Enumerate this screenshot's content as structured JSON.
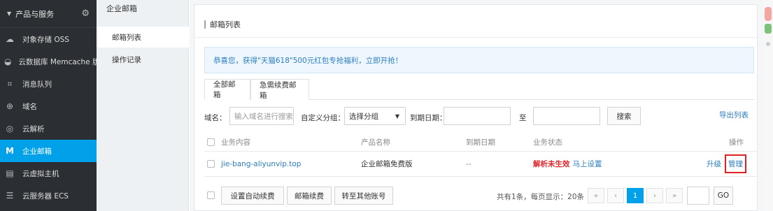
{
  "sidebar": {
    "header": "产品与服务",
    "items": [
      {
        "label": "对象存储 OSS",
        "icon": "cloud-icon"
      },
      {
        "label": "云数据库 Memcache 版",
        "icon": "database-icon"
      },
      {
        "label": "消息队列",
        "icon": "queue-icon"
      },
      {
        "label": "域名",
        "icon": "globe-icon"
      },
      {
        "label": "云解析",
        "icon": "dns-icon"
      },
      {
        "label": "企业邮箱",
        "icon": "mail-m-icon",
        "active": true
      },
      {
        "label": "云虚拟主机",
        "icon": "server-icon"
      },
      {
        "label": "云服务器 ECS",
        "icon": "ecs-icon"
      }
    ]
  },
  "subnav": {
    "title": "企业邮箱",
    "items": [
      {
        "label": "邮箱列表",
        "active": true
      },
      {
        "label": "操作记录"
      }
    ]
  },
  "main": {
    "title": "邮箱列表",
    "promo": "恭喜您，获得\"天猫618\"500元红包专抢福利，立即开抢！",
    "tabs": [
      "全部邮箱",
      "急需续费邮箱"
    ],
    "filters": {
      "domain_label": "域名：",
      "domain_placeholder": "输入域名进行搜索",
      "group_label": "自定义分组：",
      "group_value": "选择分组",
      "date_label": "到期日期：",
      "to": "至",
      "search": "搜索",
      "export": "导出列表"
    },
    "table": {
      "headers": [
        "业务内容",
        "产品名称",
        "到期日期",
        "业务状态",
        "操作"
      ],
      "rows": [
        {
          "content": "jie-bang-aliyunvip.top",
          "product": "企业邮箱免费版",
          "expire": "--",
          "status": "解析未生效",
          "status_action": "马上设置",
          "op_upgrade": "升级",
          "op_manage": "管理"
        }
      ]
    },
    "footer": {
      "btn_auto": "设置自动续费",
      "btn_renew": "邮箱续费",
      "btn_transfer": "转至其他账号",
      "page_info": "共有1条，每页显示：20条",
      "pager": [
        "«",
        "‹",
        "1",
        "›",
        "»"
      ],
      "current_page": "1",
      "go": "GO"
    }
  }
}
